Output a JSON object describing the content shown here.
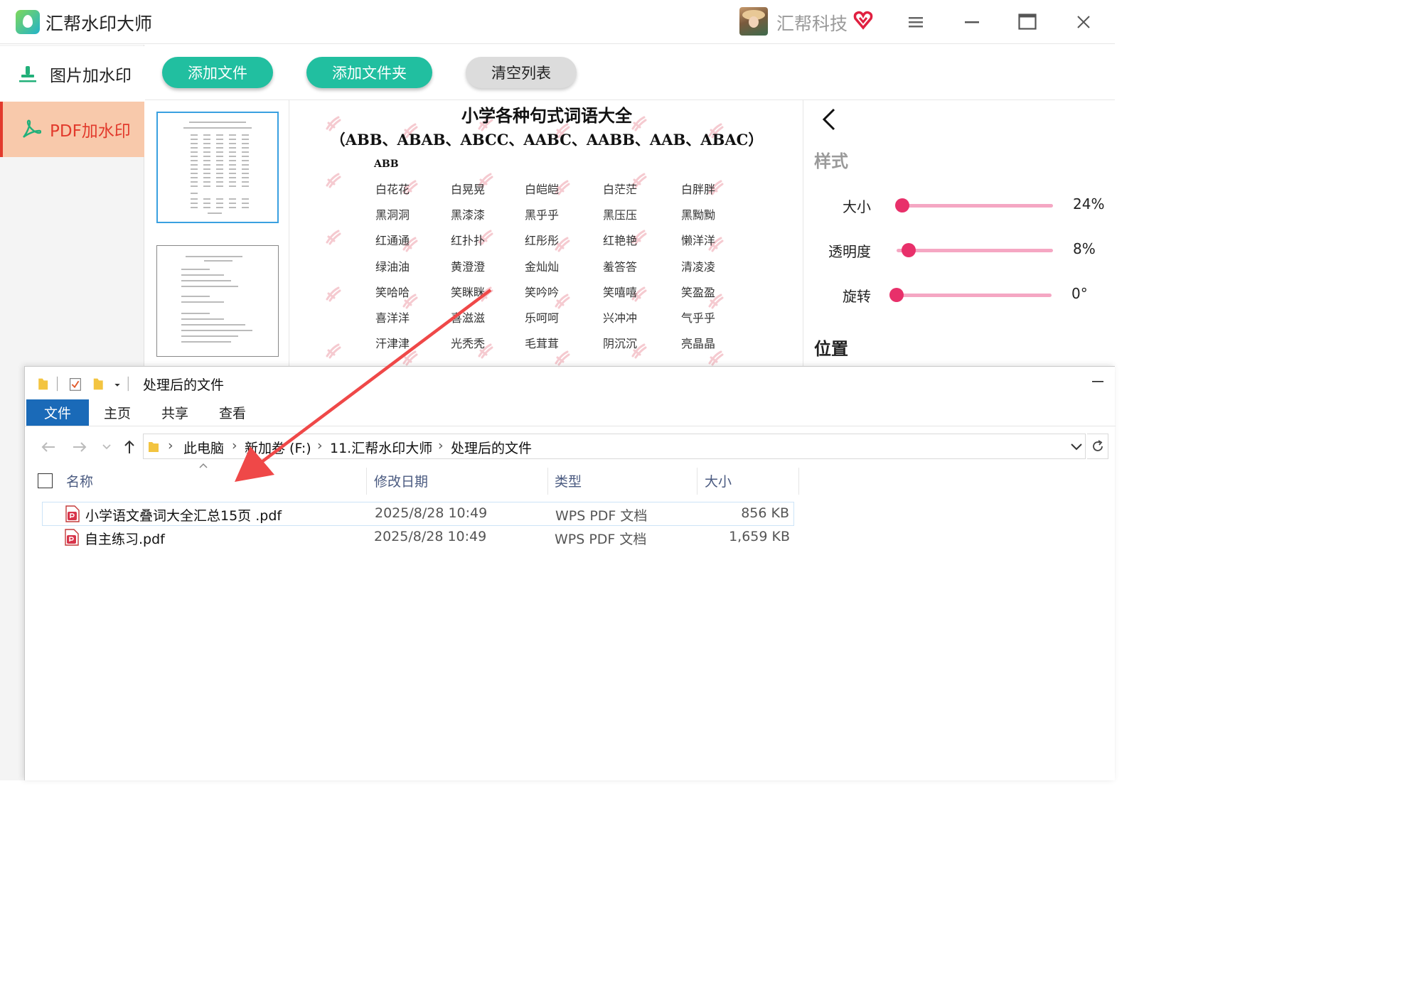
{
  "app": {
    "title": "汇帮水印大师",
    "company": "汇帮科技"
  },
  "sidebar": {
    "items": [
      {
        "label": "图片加水印"
      },
      {
        "label": "PDF加水印"
      }
    ]
  },
  "toolbar": {
    "add_file": "添加文件",
    "add_folder": "添加文件夹",
    "clear_list": "清空列表"
  },
  "preview": {
    "title": "小学各种句式词语大全",
    "subtitle": "（ABB、ABAB、ABCC、AABC、AABB、AAB、ABAC）",
    "section": "ABB",
    "rows": [
      [
        "白花花",
        "白晃晃",
        "白皑皑",
        "白茫茫",
        "白胖胖"
      ],
      [
        "黑洞洞",
        "黑漆漆",
        "黑乎乎",
        "黑压压",
        "黑黝黝"
      ],
      [
        "红通通",
        "红扑扑",
        "红彤彤",
        "红艳艳",
        "懒洋洋"
      ],
      [
        "绿油油",
        "黄澄澄",
        "金灿灿",
        "羞答答",
        "清凌凌"
      ],
      [
        "笑哈哈",
        "笑眯眯",
        "笑吟吟",
        "笑嘻嘻",
        "笑盈盈"
      ],
      [
        "喜洋洋",
        "喜滋滋",
        "乐呵呵",
        "兴冲冲",
        "气乎乎"
      ],
      [
        "汗津津",
        "光秃秃",
        "毛茸茸",
        "阴沉沉",
        "亮晶晶"
      ]
    ]
  },
  "settings": {
    "style_heading": "样式",
    "position_heading": "位置",
    "sliders": [
      {
        "label": "大小",
        "value_text": "24%",
        "fraction": 0.0
      },
      {
        "label": "透明度",
        "value_text": "8%",
        "fraction": 0.04
      },
      {
        "label": "旋转",
        "value_text": "0°",
        "fraction": 0.0
      }
    ]
  },
  "explorer": {
    "title": "处理后的文件",
    "ribbon_tabs": [
      "文件",
      "主页",
      "共享",
      "查看"
    ],
    "breadcrumb": [
      "此电脑",
      "新加卷 (F:)",
      "11.汇帮水印大师",
      "处理后的文件"
    ],
    "columns": {
      "name": "名称",
      "modified": "修改日期",
      "type": "类型",
      "size": "大小"
    },
    "files": [
      {
        "name": "小学语文叠词大全汇总15页 .pdf",
        "modified": "2025/8/28 10:49",
        "type": "WPS PDF 文档",
        "size": "856 KB"
      },
      {
        "name": "自主练习.pdf",
        "modified": "2025/8/28 10:49",
        "type": "WPS PDF 文档",
        "size": "1,659 KB"
      }
    ]
  },
  "colors": {
    "accent_teal": "#21bfa0",
    "active_red": "#e23a2c",
    "slider_pink": "#e8306a",
    "arrow_red": "#ef4848",
    "explorer_blue": "#1a6ab8"
  }
}
